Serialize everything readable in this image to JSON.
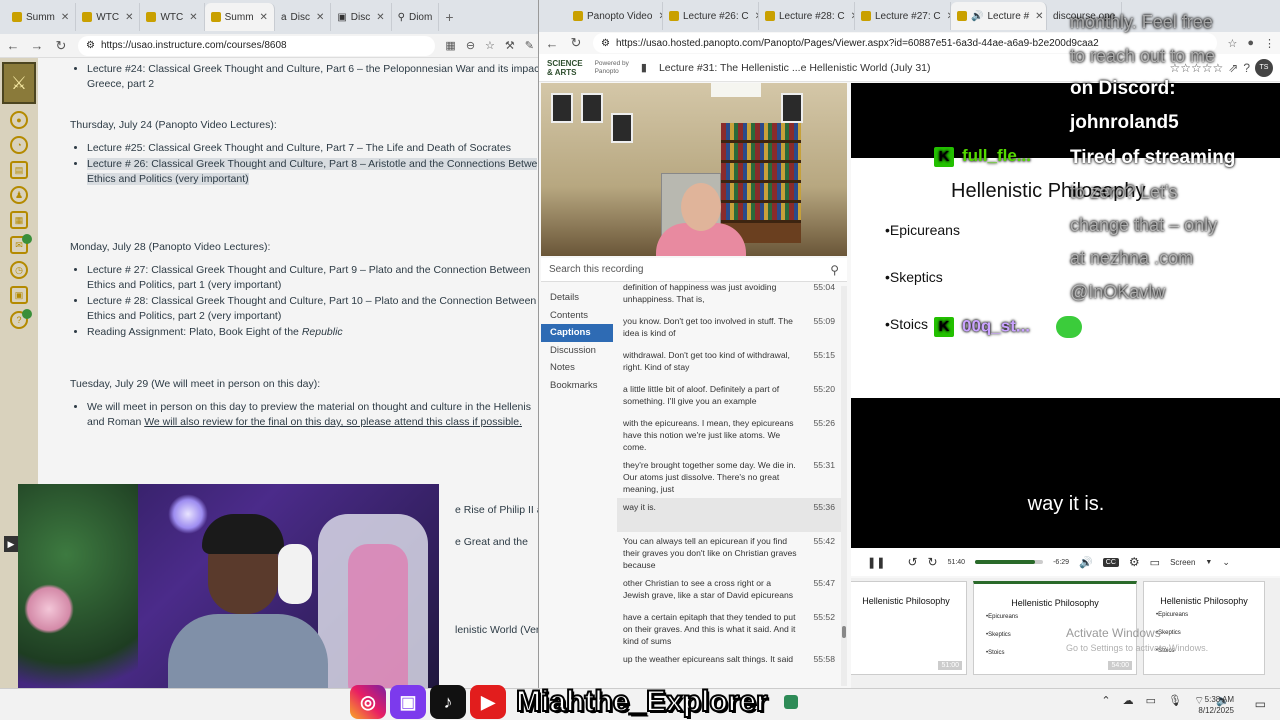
{
  "left_browser": {
    "tabs": [
      "Summ",
      "WTC",
      "WTC",
      "Summ",
      "Disc",
      "Disc",
      "Diom"
    ],
    "url": "https://usao.instructure.com/courses/8608"
  },
  "course": {
    "top_item": [
      "Lecture #24: Classical Greek Thought and Culture, Part 6 – the Peloponnesian War and its impact",
      "Greece, part 2"
    ],
    "days": [
      {
        "heading": "Thursday, July 24 (Panopto Video Lectures):",
        "items": [
          [
            "Lecture #25: Classical Greek Thought and Culture, Part 7 – The Life and Death of Socrates"
          ],
          [
            "Lecture # 26: Classical Greek Thought and Culture, Part 8 – Aristotle and the Connections Betwe",
            "Ethics and Politics (very important)"
          ]
        ]
      },
      {
        "heading": "Monday, July 28 (Panopto Video Lectures):",
        "items": [
          [
            "Lecture # 27: Classical Greek Thought and Culture, Part 9 – Plato and the Connection Between",
            "Ethics and Politics, part 1 (very important)"
          ],
          [
            "Lecture # 28: Classical Greek Thought and Culture, Part 10 – Plato and the Connection Between",
            "Ethics and Politics, part 2 (very important)"
          ],
          [
            "Reading Assignment: Plato, Book Eight of the Republic"
          ]
        ]
      },
      {
        "heading": "Tuesday, July 29 (We will meet in person on this day):",
        "items": [
          [
            "We will meet in person on this day to preview the material on thought and culture in the Hellenis",
            "and Roman We will also review for the final on this day, so please attend this class if possible."
          ]
        ]
      }
    ],
    "reading_prefix": "Reading Assignment: Plato, Book Eight of the ",
    "reading_title": "Republic",
    "tuesday_line2_plain": "and Roman ",
    "tuesday_line2_ul": "We will also review for the final on this day, so please attend this class if possible.",
    "tail": [
      "e Rise of Philip II and",
      "e Great and the",
      "lenistic World (Very"
    ]
  },
  "right_browser": {
    "tabs": [
      "Panopto Video",
      "Lecture #26: C",
      "Lecture #28: C",
      "Lecture #27: C",
      "Lecture #",
      "discourse.ope"
    ],
    "url": "https://usao.hosted.panopto.com/Panopto/Pages/Viewer.aspx?id=60887e51-6a3d-44ae-a6a9-b2e200d9caa2",
    "brand": [
      "SCIENCE",
      "& ARTS"
    ],
    "powered_by": [
      "Powered by",
      "Panopto"
    ],
    "session_title": "Lecture #31: The Hellenistic ...e Hellenistic World (July 31)",
    "avatar": "TS",
    "search_placeholder": "Search this recording",
    "side_tabs": [
      "Details",
      "Contents",
      "Captions",
      "Discussion",
      "Notes",
      "Bookmarks"
    ],
    "active_tab": "Captions",
    "captions": [
      {
        "text": "definition of happiness was just avoiding unhappiness. That is,",
        "time": "55:04"
      },
      {
        "text": "you know. Don't get too involved in stuff. The idea is kind of",
        "time": "55:09"
      },
      {
        "text": "withdrawal. Don't get too kind of withdrawal, right. Kind of stay",
        "time": "55:15"
      },
      {
        "text": "a little little bit of aloof. Definitely a part of something. I'll give you an example",
        "time": "55:20"
      },
      {
        "text": "with the epicureans. I mean, they epicureans have this notion we're just like atoms. We come.",
        "time": "55:26"
      },
      {
        "text": "they're brought together some day. We die in. Our atoms just dissolve. There's no great meaning, just",
        "time": "55:31"
      },
      {
        "text": "way it is.",
        "time": "55:36"
      },
      {
        "text": "You can always tell an epicurean if you find their graves you don't like on Christian graves because",
        "time": "55:42"
      },
      {
        "text": "other Christian to see a cross right or a Jewish grave, like a star of David epicureans",
        "time": "55:47"
      },
      {
        "text": "have a certain epitaph that they tended to put on their graves. And this is what it said. And it kind of sums",
        "time": "55:52"
      },
      {
        "text": "up the weather epicureans salt things. It said",
        "time": "55:58"
      }
    ],
    "slide": {
      "title": "Hellenistic Philosophy",
      "bullets": [
        "•Epicureans",
        "•Skeptics",
        "•Stoics"
      ]
    },
    "subtitle": "way it is.",
    "player": {
      "elapsed": "51:40",
      "remaining": "-6:29",
      "progress": 0.88,
      "cc": "CC",
      "layout": "Screen"
    },
    "thumbnails": [
      {
        "title": "Hellenistic Philosophy",
        "bullets": [],
        "time": "51:00"
      },
      {
        "title": "Hellenistic Philosophy",
        "bullets": [
          "•Epicureans",
          "•Skeptics",
          "•Stoics"
        ],
        "time": "54:00"
      },
      {
        "title": "Hellenistic Philosophy",
        "bullets": [
          "•Epicureans",
          "•Skeptics",
          "•Stoics"
        ],
        "time": ""
      }
    ]
  },
  "overlay": {
    "chat_lines": [
      {
        "text": "monthly. Feel free",
        "ghost": true
      },
      {
        "text": "to reach out to me",
        "ghost": true
      },
      {
        "text": "on Discord:",
        "ghost": false
      },
      {
        "text": "johnroland5",
        "ghost": false
      },
      {
        "text": "Tired of streaming",
        "ghost": false
      },
      {
        "text": "to zero? Let's",
        "ghost": true
      },
      {
        "text": "change that – only",
        "ghost": true
      },
      {
        "text": "at nezhna .com",
        "ghost": true
      },
      {
        "text": "@InOKavlw",
        "ghost": true
      }
    ],
    "kick_user_1": "full_fle...",
    "kick_user_2": "00q_st...",
    "kick_letter": "K",
    "social_handle": "Miahthe_Explorer",
    "activate_title": "Activate Windows",
    "activate_sub": "Go to Settings to activate Windows."
  },
  "taskbar": {
    "time": "5:38 AM",
    "date": "8/12/2025"
  },
  "colors": {
    "panopto_blue": "#2e6bb4",
    "kick_green": "#23c000",
    "canvas_gold": "#b48a00"
  }
}
